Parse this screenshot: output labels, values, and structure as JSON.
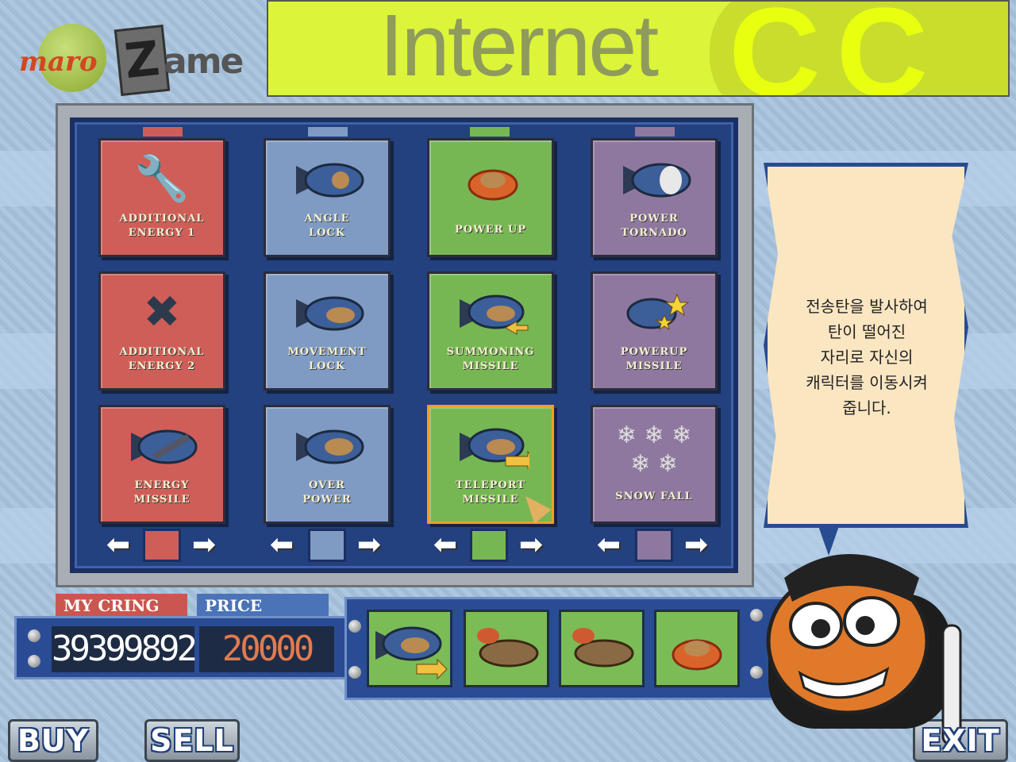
{
  "logo": {
    "part1": "maro",
    "part2": "ame",
    "z_letter": "Z"
  },
  "banner": {
    "tagline": "Internet",
    "cc": "CC"
  },
  "colors": {
    "red": "#cf5e58",
    "blue": "#7f9bc3",
    "green": "#77b753",
    "purple": "#8f789f",
    "panel": "#23407f"
  },
  "items": [
    {
      "name": "ADDITIONAL\nENERGY 1",
      "icon": "wrench-icon",
      "color": "red"
    },
    {
      "name": "ANGLE\nLOCK",
      "icon": "missile-icon",
      "color": "blue"
    },
    {
      "name": "POWER UP",
      "icon": "fire-ring-icon",
      "color": "green"
    },
    {
      "name": "POWER\nTORNADO",
      "icon": "missile-icon",
      "color": "purple"
    },
    {
      "name": "ADDITIONAL\nENERGY 2",
      "icon": "crossed-wrenches-icon",
      "color": "red"
    },
    {
      "name": "MOVEMENT\nLOCK",
      "icon": "missile-icon",
      "color": "blue"
    },
    {
      "name": "SUMMONING\nMISSILE",
      "icon": "missile-icon",
      "color": "green"
    },
    {
      "name": "POWERUP\nMISSILE",
      "icon": "stars-missile-icon",
      "color": "purple"
    },
    {
      "name": "ENERGY\nMISSILE",
      "icon": "missile-icon",
      "color": "red"
    },
    {
      "name": "OVER\nPOWER",
      "icon": "missile-icon",
      "color": "blue"
    },
    {
      "name": "TELEPORT\nMISSILE",
      "icon": "missile-icon",
      "color": "green",
      "selected": true
    },
    {
      "name": "SNOW FALL",
      "icon": "snowflake-icon",
      "color": "purple"
    }
  ],
  "description": "전송탄을 발사하여\n탄이 떨어진\n자리로 자신의\n캐릭터를 이동시켜\n줍니다.",
  "wallet": {
    "my_label": "MY CRING",
    "price_label": "PRICE",
    "my_value": "39399892",
    "price_value": "20000"
  },
  "cart": [
    {
      "icon": "teleport-missile-icon"
    },
    {
      "icon": "tank-icon"
    },
    {
      "icon": "tank-icon"
    },
    {
      "icon": "fire-ring-icon"
    }
  ],
  "buttons": {
    "buy": "BUY",
    "sell": "SELL",
    "exit": "EXIT"
  }
}
